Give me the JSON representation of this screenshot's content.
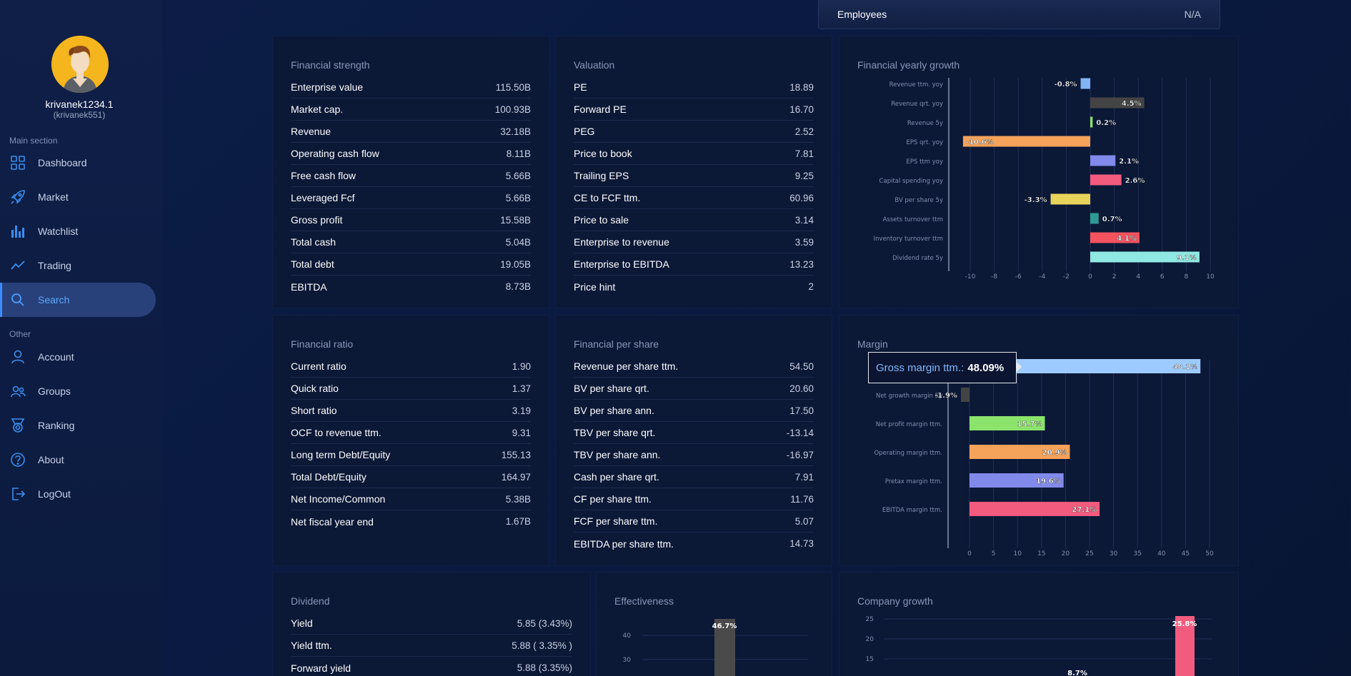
{
  "user": {
    "name": "krivanek1234.1",
    "handle": "(krivanek551)"
  },
  "sidebar": {
    "main_label": "Main section",
    "other_label": "Other",
    "main_items": [
      {
        "label": "Dashboard",
        "icon": "dashboard-icon"
      },
      {
        "label": "Market",
        "icon": "rocket-icon"
      },
      {
        "label": "Watchlist",
        "icon": "bar-chart-icon"
      },
      {
        "label": "Trading",
        "icon": "trend-line-icon"
      },
      {
        "label": "Search",
        "icon": "search-icon",
        "active": true
      }
    ],
    "other_items": [
      {
        "label": "Account",
        "icon": "user-icon"
      },
      {
        "label": "Groups",
        "icon": "users-icon"
      },
      {
        "label": "Ranking",
        "icon": "medal-icon"
      },
      {
        "label": "About",
        "icon": "help-icon"
      },
      {
        "label": "LogOut",
        "icon": "logout-icon"
      }
    ]
  },
  "employees": {
    "label": "Employees",
    "value": "N/A"
  },
  "financial_strength": {
    "title": "Financial strength",
    "rows": [
      {
        "label": "Enterprise value",
        "value": "115.50B"
      },
      {
        "label": "Market cap.",
        "value": "100.93B"
      },
      {
        "label": "Revenue",
        "value": "32.18B"
      },
      {
        "label": "Operating cash flow",
        "value": "8.11B"
      },
      {
        "label": "Free cash flow",
        "value": "5.66B"
      },
      {
        "label": "Leveraged Fcf",
        "value": "5.66B"
      },
      {
        "label": "Gross profit",
        "value": "15.58B"
      },
      {
        "label": "Total cash",
        "value": "5.04B"
      },
      {
        "label": "Total debt",
        "value": "19.05B"
      },
      {
        "label": "EBITDA",
        "value": "8.73B"
      }
    ]
  },
  "valuation": {
    "title": "Valuation",
    "rows": [
      {
        "label": "PE",
        "value": "18.89"
      },
      {
        "label": "Forward PE",
        "value": "16.70"
      },
      {
        "label": "PEG",
        "value": "2.52"
      },
      {
        "label": "Price to book",
        "value": "7.81"
      },
      {
        "label": "Trailing EPS",
        "value": "9.25"
      },
      {
        "label": "CE to FCF ttm.",
        "value": "60.96"
      },
      {
        "label": "Price to sale",
        "value": "3.14"
      },
      {
        "label": "Enterprise to revenue",
        "value": "3.59"
      },
      {
        "label": "Enterprise to EBITDA",
        "value": "13.23"
      },
      {
        "label": "Price hint",
        "value": "2"
      }
    ]
  },
  "financial_ratio": {
    "title": "Financial ratio",
    "rows": [
      {
        "label": "Current ratio",
        "value": "1.90"
      },
      {
        "label": "Quick ratio",
        "value": "1.37"
      },
      {
        "label": "Short ratio",
        "value": "3.19"
      },
      {
        "label": "OCF to revenue ttm.",
        "value": "9.31"
      },
      {
        "label": "Long term Debt/Equity",
        "value": "155.13"
      },
      {
        "label": "Total Debt/Equity",
        "value": "164.97"
      },
      {
        "label": "Net Income/Common",
        "value": "5.38B"
      },
      {
        "label": "Net fiscal year end",
        "value": "1.67B"
      }
    ]
  },
  "financial_per_share": {
    "title": "Financial per share",
    "rows": [
      {
        "label": "Revenue per share ttm.",
        "value": "54.50"
      },
      {
        "label": "BV per share qrt.",
        "value": "20.60"
      },
      {
        "label": "BV per share ann.",
        "value": "17.50"
      },
      {
        "label": "TBV per share qrt.",
        "value": "-13.14"
      },
      {
        "label": "TBV per share ann.",
        "value": "-16.97"
      },
      {
        "label": "Cash per share qrt.",
        "value": "7.91"
      },
      {
        "label": "CF per share ttm.",
        "value": "11.76"
      },
      {
        "label": "FCF per share ttm.",
        "value": "5.07"
      },
      {
        "label": "EBITDA per share ttm.",
        "value": "14.73"
      }
    ]
  },
  "dividend": {
    "title": "Dividend",
    "rows": [
      {
        "label": "Yield",
        "value": "5.85 (3.43%)"
      },
      {
        "label": "Yield ttm.",
        "value": "5.88 ( 3.35% )"
      },
      {
        "label": "Forward yield",
        "value": "5.88 (3.35%)"
      }
    ]
  },
  "growth_panel": {
    "title": "Financial yearly growth"
  },
  "margin_panel": {
    "title": "Margin"
  },
  "effectiveness_panel": {
    "title": "Effectiveness"
  },
  "company_growth_panel": {
    "title": "Company growth"
  },
  "tooltip": {
    "label": "Gross margin ttm.:",
    "value": "48.09%"
  },
  "chart_data": [
    {
      "type": "bar",
      "orientation": "horizontal",
      "categories": [
        "Revenue ttm. yoy",
        "Revenue qrt. yoy",
        "Revenue 5y",
        "EPS qrt. yoy",
        "EPS ttm yoy",
        "Capital spending yoy",
        "BV per share 5y",
        "Assets turnover ttm",
        "Inventory turnover ttm",
        "Dividend rate 5y"
      ],
      "values": [
        -0.8,
        4.5,
        0.2,
        -10.6,
        2.1,
        2.6,
        -3.3,
        0.7,
        4.1,
        9.1
      ],
      "labels": [
        "-0.8%",
        "4.5%",
        "0.2%",
        "-10.6%",
        "2.1%",
        "2.6%",
        "-3.3%",
        "0.7%",
        "4.1%",
        "9.1%"
      ],
      "colors": [
        "#82b4f5",
        "#444444",
        "#8be36b",
        "#f5a25a",
        "#8189ea",
        "#f25b7e",
        "#e8d35a",
        "#2e9a96",
        "#f2535f",
        "#8fe8e2"
      ],
      "xlim": [
        -10,
        10
      ],
      "xticks": [
        "-10",
        "-8",
        "-6",
        "-4",
        "-2",
        "0",
        "2",
        "4",
        "6",
        "8",
        "10"
      ],
      "grid": true
    },
    {
      "type": "bar",
      "orientation": "horizontal",
      "categories": [
        "Gross margin ttm.",
        "Net growth margin 5y",
        "Net profit margin ttm.",
        "Operating margin ttm.",
        "Pretax margin ttm.",
        "EBITDA margin ttm."
      ],
      "values": [
        48.1,
        -1.9,
        15.7,
        20.9,
        19.6,
        27.1
      ],
      "labels": [
        "48.1%",
        "-1.9%",
        "15.7%",
        "20.9%",
        "19.6%",
        "27.1%"
      ],
      "colors": [
        "#9ecbff",
        "#444444",
        "#8be36b",
        "#f5a25a",
        "#8189ea",
        "#f25b7e"
      ],
      "xlim": [
        0,
        50
      ],
      "xticks": [
        "0",
        "5",
        "10",
        "15",
        "20",
        "25",
        "30",
        "35",
        "40",
        "45",
        "50"
      ],
      "grid": true
    },
    {
      "type": "bar",
      "categories": [
        ""
      ],
      "values": [
        46.7
      ],
      "labels": [
        "46.7%"
      ],
      "yticks": [
        "40",
        "30"
      ],
      "colors": [
        "#4a4a4a"
      ]
    },
    {
      "type": "bar",
      "values": [
        8.7,
        25.8
      ],
      "labels": [
        "8.7%",
        "25.8%"
      ],
      "yticks": [
        "25",
        "20",
        "15"
      ],
      "colors": [
        "#f25b7e"
      ]
    }
  ]
}
